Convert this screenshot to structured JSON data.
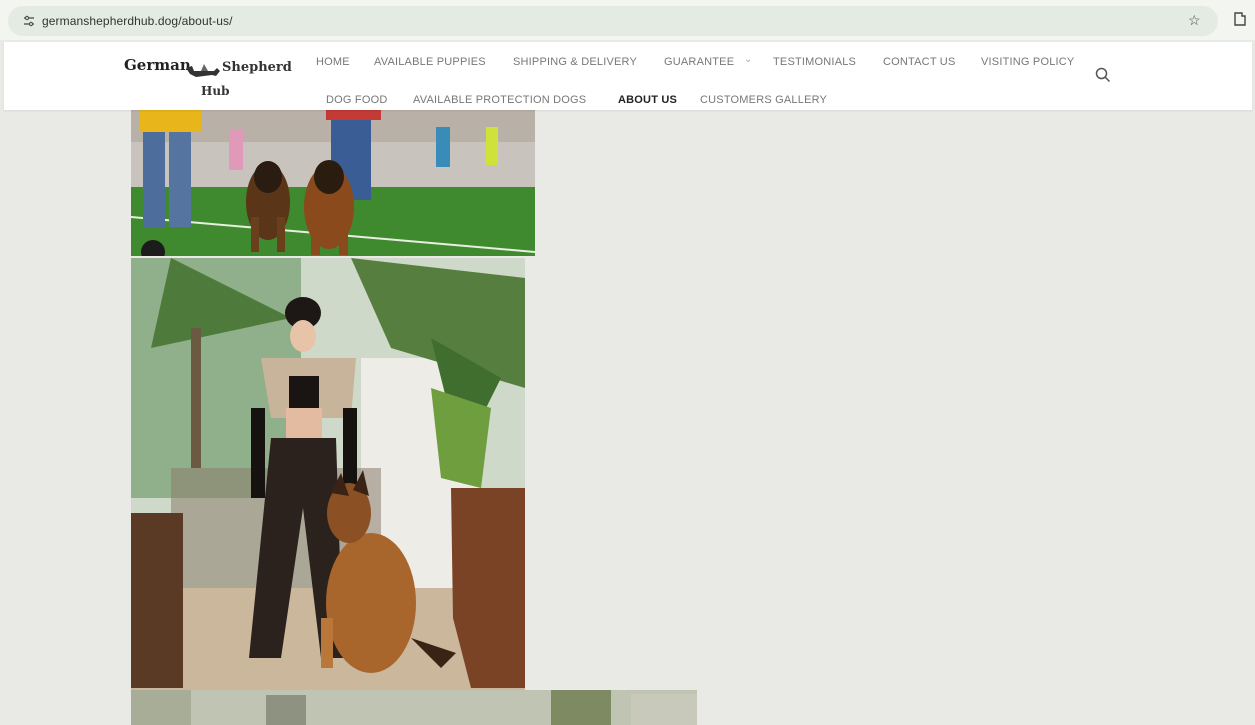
{
  "browser": {
    "url": "germanshepherdhub.dog/about-us/",
    "icons": [
      "site-info-icon",
      "bookmark-star-icon",
      "extensions-icon"
    ]
  },
  "site": {
    "logo": {
      "word1": "German",
      "word2": "Shepherd",
      "word3": "Hub"
    },
    "nav_row1": [
      "HOME",
      "AVAILABLE PUPPIES",
      "SHIPPING & DELIVERY",
      "GUARANTEE",
      "TESTIMONIALS",
      "CONTACT US",
      "VISITING POLICY"
    ],
    "nav_row2": [
      "DOG FOOD",
      "AVAILABLE PROTECTION DOGS",
      "ABOUT US",
      "CUSTOMERS GALLERY"
    ],
    "active_nav": "ABOUT US",
    "dropdown_indicator": "⌄"
  },
  "colors": {
    "page_bg": "#e9eae6",
    "header_bg": "#ffffff",
    "nav_text": "#777777",
    "nav_active": "#222222"
  }
}
